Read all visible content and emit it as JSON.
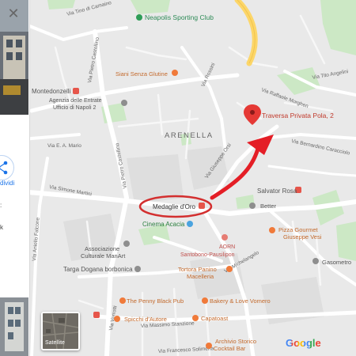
{
  "map": {
    "pois": {
      "neapolis": "Neapolis Sporting Club",
      "siani": "Siani Senza Glutine",
      "montedonzelli": "Montedonzelli",
      "agenzia_1": "Agenzia delle Entrate",
      "agenzia_2": "Ufficio di Napoli 2",
      "destination": "Traversa Privata Pola, 2",
      "arenella": "ARENELLA",
      "medaglie": "Medaglie d'Oro",
      "salvator": "Salvator Rosa",
      "better": "Better",
      "cinema": "Cinema Acacia",
      "pizza_1": "Pizza Gourmet",
      "pizza_2": "Giuseppe Vesi",
      "assoc_1": "Associazione",
      "assoc_2": "Culturale ManArt",
      "aorn_1": "AORN",
      "aorn_2": "Santobono-Pausilipon",
      "gasometro": "Gasometro",
      "targa": "Targa Dogana borbonica",
      "tortora_1": "Tortora Panino",
      "tortora_2": "Macelleria",
      "pennyblack": "The Penny Black Pub",
      "bakery": "Bakery & Love Vomero",
      "spicchi": "Spicchi d'Autore",
      "capatoast": "Capatoast",
      "archivio_1": "Archivio Storico",
      "archivio_2": "Cocktail Bar"
    },
    "streets": {
      "pietro_castellino_top": "Via Pietro Castellino",
      "pietro_castellino_mid": "Via Pietro Castellino",
      "rossini": "Via Rossini",
      "giuseppe_orsi": "Via Giuseppe Orsi",
      "simone_martini": "Via Simone Martini",
      "rosalba": "Via Raffaele Morghen",
      "michelangelo": "Via Michelangelo",
      "tino_camaino": "Via Tino di Camaino",
      "francesco_solimena": "Via Francesco Solimena",
      "massimo_stanzione": "Via Massimo Stanzione",
      "belvedere": "Via Belvedere",
      "caracciolo": "Via Bernardino Caracciolo",
      "aniello_falcone": "Via Aniello Falcone",
      "domenico_fontana": "Via Domenico Fontana",
      "e_a_mario": "Via E. A. Mario",
      "tito_angelini": "Via Tito Angelini",
      "belmonte": "Via Bonito",
      "verrotti": "Via Verrotti",
      "gemito": "Via Gemito"
    },
    "marker_colors": {
      "destination_pin": "#e53935",
      "circle": "#d32f2f",
      "arrow": "#e41e26",
      "food_poi": "#f07a3a",
      "place_poi": "#8e8e8e",
      "transit_poi": "#e6554a",
      "health_poi": "#e67c73",
      "park": "#c8e6c9"
    }
  },
  "side_panel": {
    "close_icon": "✕",
    "share_label": "dividi",
    "truncated_text_1": ":",
    "truncated_text_2": "k"
  },
  "satellite_toggle": {
    "label": "Satellite"
  },
  "google_logo": {
    "text": "Google"
  }
}
